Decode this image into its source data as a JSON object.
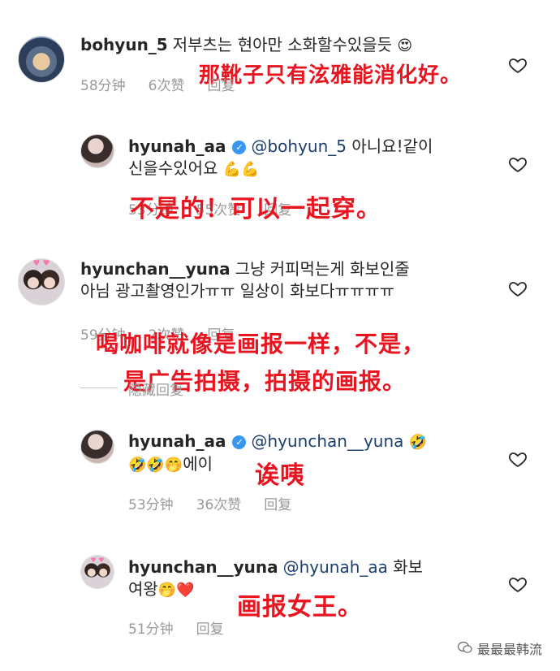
{
  "comments": [
    {
      "username": "bohyun_5",
      "text": "저부츠는 현아만 소화할수있을듯",
      "emoji": "😍",
      "time": "58分钟",
      "likes": "6次赞",
      "reply": "回复",
      "translation": "那靴子只有泫雅能消化好。"
    },
    {
      "username": "hyunah_aa",
      "mention": "@bohyun_5",
      "text_line1": "아니요!같이",
      "text_line2": "신을수있어요",
      "emoji": "💪💪",
      "time": "53分钟",
      "likes": "55次赞",
      "reply": "回复",
      "translation": "不是的！可以一起穿。"
    },
    {
      "username": "hyunchan__yuna",
      "text_line1": "그냥 커피먹는게 화보인줄",
      "text_line2": "아님 광고촬영인가ㅠㅠ 일상이 화보다ㅠㅠㅠㅠ",
      "time": "59分钟",
      "likes": "2次赞",
      "reply": "回复",
      "hide_replies": "隐藏回复",
      "translation_line1": "喝咖啡就像是画报一样，不是，",
      "translation_line2": "是广告拍摄，拍摄的画报。"
    },
    {
      "username": "hyunah_aa",
      "mention": "@hyunchan__yuna",
      "emoji_line1": "🤣",
      "emoji_line2": "🤣🤣🤭",
      "text": "에이",
      "time": "53分钟",
      "likes": "36次赞",
      "reply": "回复",
      "translation": "诶咦"
    },
    {
      "username": "hyunchan__yuna",
      "mention": "@hyunah_aa",
      "text_line1": "화보",
      "text_line2": "여왕",
      "emoji": "🤭❤️",
      "time": "51分钟",
      "reply": "回复",
      "translation": "画报女王。"
    }
  ],
  "watermark": "最最最韩流",
  "colors": {
    "translation": "#e8141f",
    "meta": "#999999",
    "verified": "#3897f0"
  },
  "icons": [
    "heart-icon",
    "verified-badge-icon",
    "wechat-icon"
  ]
}
